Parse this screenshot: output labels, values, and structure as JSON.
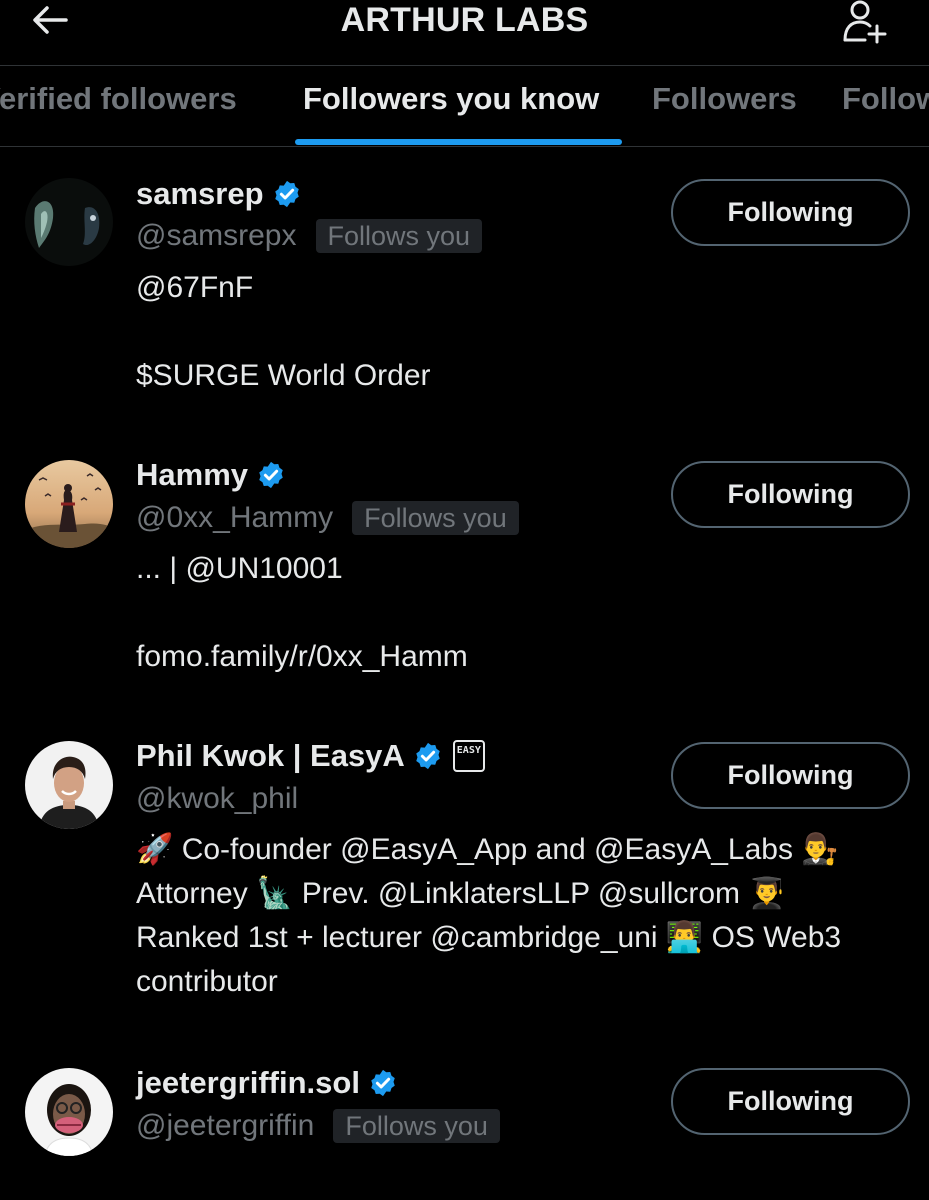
{
  "header": {
    "title": "ARTHUR LABS",
    "back_icon": "arrow-left-icon",
    "add_user_icon": "person-add-icon"
  },
  "tabs": [
    {
      "label": "Verified followers",
      "visible_text": "Verified followers"
    },
    {
      "label": "Followers you know",
      "active": true
    },
    {
      "label": "Followers"
    },
    {
      "label": "Following",
      "visible_text": "Follow"
    }
  ],
  "colors": {
    "accent": "#1d9bf0",
    "background": "#000000",
    "muted_text": "#71767b",
    "primary_text": "#e7e9ea"
  },
  "users": [
    {
      "name": "samsrep",
      "handle": "@samsrepx",
      "follows_you": "Follows you",
      "bio": "@67FnF\n\n$SURGE World Order",
      "button": "Following",
      "verified": true
    },
    {
      "name": "Hammy",
      "handle": "@0xx_Hammy",
      "follows_you": "Follows you",
      "bio": "... | @UN10001\n\nfomo.family/r/0xx_Hamm",
      "button": "Following",
      "verified": true
    },
    {
      "name": "Phil Kwok | EasyA",
      "handle": "@kwok_phil",
      "badge_text": "EASY",
      "bio": "🚀 Co-founder @EasyA_App and @EasyA_Labs 👨‍⚖️\nAttorney 🗽 Prev. @LinklatersLLP @sullcrom 👨‍🎓\nRanked 1st + lecturer @cambridge_uni 👨‍💻 OS Web3\ncontributor",
      "button": "Following",
      "verified": true
    },
    {
      "name": "jeetergriffin.sol",
      "handle": "@jeetergriffin",
      "follows_you": "Follows you",
      "button": "Following",
      "verified": true
    }
  ]
}
